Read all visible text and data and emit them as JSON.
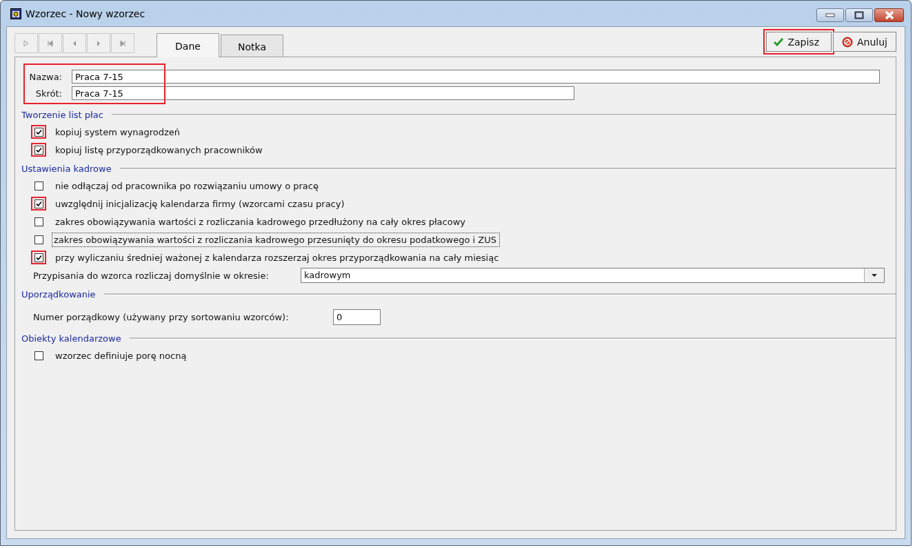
{
  "window": {
    "title": "Wzorzec - Nowy wzorzec"
  },
  "tabs": [
    {
      "label": "Dane",
      "selected": true
    },
    {
      "label": "Notka",
      "selected": false
    }
  ],
  "actions": [
    {
      "kind": "save",
      "label": "Zapisz",
      "highlighted": true
    },
    {
      "kind": "cancel",
      "label": "Anuluj",
      "highlighted": false
    }
  ],
  "identity": {
    "highlighted": true,
    "fields": [
      {
        "kind": "wide",
        "label": "Nazwa:",
        "value": "Praca 7-15"
      },
      {
        "kind": "medium",
        "label": "Skrót:",
        "value": "Praca 7-15"
      }
    ]
  },
  "sections": [
    {
      "title": "Tworzenie list płac",
      "items": [
        {
          "kind": "checkbox",
          "label": "kopiuj system wynagrodzeń",
          "checked": true,
          "highlighted": true,
          "focused": false
        },
        {
          "kind": "checkbox",
          "label": "kopiuj listę przyporządkowanych pracowników",
          "checked": true,
          "highlighted": true,
          "focused": false
        }
      ]
    },
    {
      "title": "Ustawienia kadrowe",
      "items": [
        {
          "kind": "checkbox",
          "label": "nie odłączaj od pracownika po rozwiązaniu umowy o pracę",
          "checked": false,
          "highlighted": false,
          "focused": false
        },
        {
          "kind": "checkbox",
          "label": "uwzględnij inicjalizację kalendarza firmy (wzorcami czasu pracy)",
          "checked": true,
          "highlighted": true,
          "focused": false
        },
        {
          "kind": "checkbox",
          "label": "zakres obowiązywania wartości z rozliczania kadrowego przedłużony na cały okres płacowy",
          "checked": false,
          "highlighted": false,
          "focused": false
        },
        {
          "kind": "checkbox",
          "label": "zakres obowiązywania wartości z rozliczania kadrowego przesunięty do okresu podatkowego i ZUS",
          "checked": false,
          "highlighted": false,
          "focused": true
        },
        {
          "kind": "checkbox",
          "label": "przy wyliczaniu średniej ważonej z kalendarza rozszerzaj okres przyporządkowania na cały miesiąc",
          "checked": true,
          "highlighted": true,
          "focused": false
        },
        {
          "kind": "combo",
          "label": "Przypisania do wzorca rozliczaj domyślnie w okresie:",
          "value": "kadrowym"
        }
      ]
    },
    {
      "title": "Uporządkowanie",
      "items": [
        {
          "kind": "number",
          "label": "Numer porządkowy (używany przy sortowaniu wzorców):",
          "value": "0"
        }
      ]
    },
    {
      "title": "Obiekty kalendarzowe",
      "items": [
        {
          "kind": "checkbox",
          "label": "wzorzec definiuje porę nocną",
          "checked": false,
          "highlighted": false,
          "focused": false
        }
      ]
    }
  ]
}
